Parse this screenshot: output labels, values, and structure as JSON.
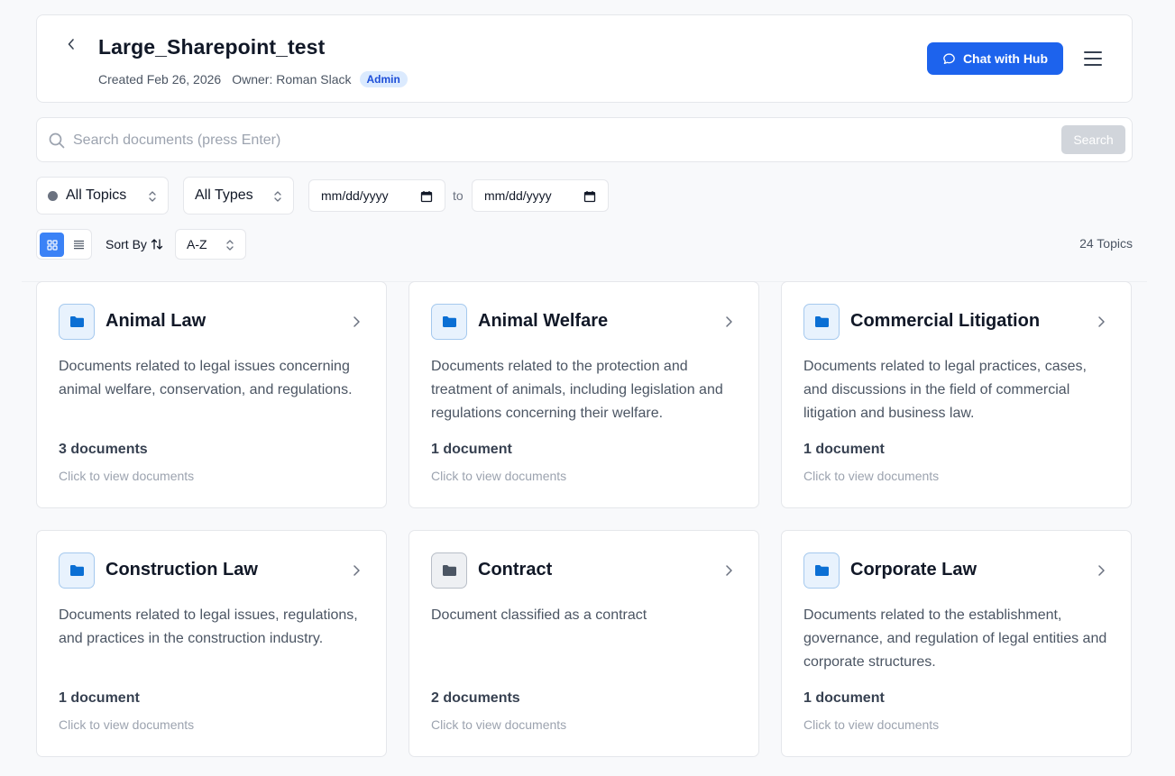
{
  "header": {
    "title": "Large_Sharepoint_test",
    "created": "Created Feb 26, 2026",
    "owner": "Owner: Roman Slack",
    "badge": "Admin",
    "chat_button": "Chat with Hub"
  },
  "search": {
    "placeholder": "Search documents (press Enter)",
    "value": "",
    "button": "Search"
  },
  "filters": {
    "topics": "All Topics",
    "types": "All Types",
    "date_from": "mm/dd/yyyy",
    "date_separator": "to",
    "date_to": "mm/dd/yyyy"
  },
  "toolbar": {
    "sort_label": "Sort By",
    "sort_value": "A-Z",
    "topic_count": "24 Topics",
    "active_view": "grid"
  },
  "colors": {
    "primary": "#1d63ed",
    "folder_blue": "#0b6fd4",
    "folder_gray": "#4b5563"
  },
  "topics": [
    {
      "title": "Animal Law",
      "description": "Documents related to legal issues concerning animal welfare, conservation, and regulations.",
      "count": "3 documents",
      "hint": "Click to view documents",
      "icon": "folder-icon",
      "color": "blue"
    },
    {
      "title": "Animal Welfare",
      "description": "Documents related to the protection and treatment of animals, including legislation and regulations concerning their welfare.",
      "count": "1 document",
      "hint": "Click to view documents",
      "icon": "folder-icon",
      "color": "blue"
    },
    {
      "title": "Commercial Litigation",
      "description": "Documents related to legal practices, cases, and discussions in the field of commercial litigation and business law.",
      "count": "1 document",
      "hint": "Click to view documents",
      "icon": "folder-icon",
      "color": "blue"
    },
    {
      "title": "Construction Law",
      "description": "Documents related to legal issues, regulations, and practices in the construction industry.",
      "count": "1 document",
      "hint": "Click to view documents",
      "icon": "folder-icon",
      "color": "blue"
    },
    {
      "title": "Contract",
      "description": "Document classified as a contract",
      "count": "2 documents",
      "hint": "Click to view documents",
      "icon": "folder-icon",
      "color": "gray"
    },
    {
      "title": "Corporate Law",
      "description": "Documents related to the establishment, governance, and regulation of legal entities and corporate structures.",
      "count": "1 document",
      "hint": "Click to view documents",
      "icon": "folder-icon",
      "color": "blue"
    }
  ]
}
